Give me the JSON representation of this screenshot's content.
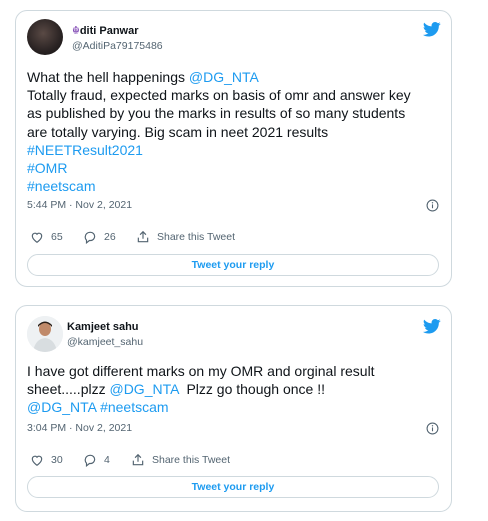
{
  "tweets": [
    {
      "author": {
        "name_symbol": "☬",
        "name": "diti Panwar",
        "handle": "@AditiPa79175486"
      },
      "text": {
        "l1_prefix": "What the hell happenings ",
        "l1_mention": "@DG_NTA",
        "l2": "Totally fraud, expected marks on basis of omr and answer key",
        "l3": "as published by you the marks in results of so many students",
        "l4": "are totally varying. Big scam in neet 2021 results",
        "hashtags": [
          "#NEETResult2021",
          "#OMR",
          "#neetscam"
        ]
      },
      "timestamp": "5:44 PM · Nov 2, 2021",
      "likes": "65",
      "replies": "26",
      "share_label": "Share this Tweet",
      "reply_button": "Tweet your reply"
    },
    {
      "author": {
        "name": "Kamjeet sahu",
        "handle": "@kamjeet_sahu"
      },
      "text": {
        "l1": "I have got different marks on my OMR and orginal result",
        "l2_prefix": "sheet.....plzz ",
        "l2_mention": "@DG_NTA",
        "l2_suffix": "  Plzz go though once !!",
        "l3_mention": "@DG_NTA",
        "l3_hashtag": "#neetscam"
      },
      "timestamp": "3:04 PM · Nov 2, 2021",
      "likes": "30",
      "replies": "4",
      "share_label": "Share this Tweet",
      "reply_button": "Tweet your reply"
    }
  ],
  "colors": {
    "link": "#1d9bf0",
    "text": "#0f1419",
    "muted": "#536471",
    "border": "#cfd9de"
  },
  "icons": [
    "twitter-bird-icon",
    "info-icon",
    "heart-icon",
    "reply-icon",
    "share-icon"
  ]
}
